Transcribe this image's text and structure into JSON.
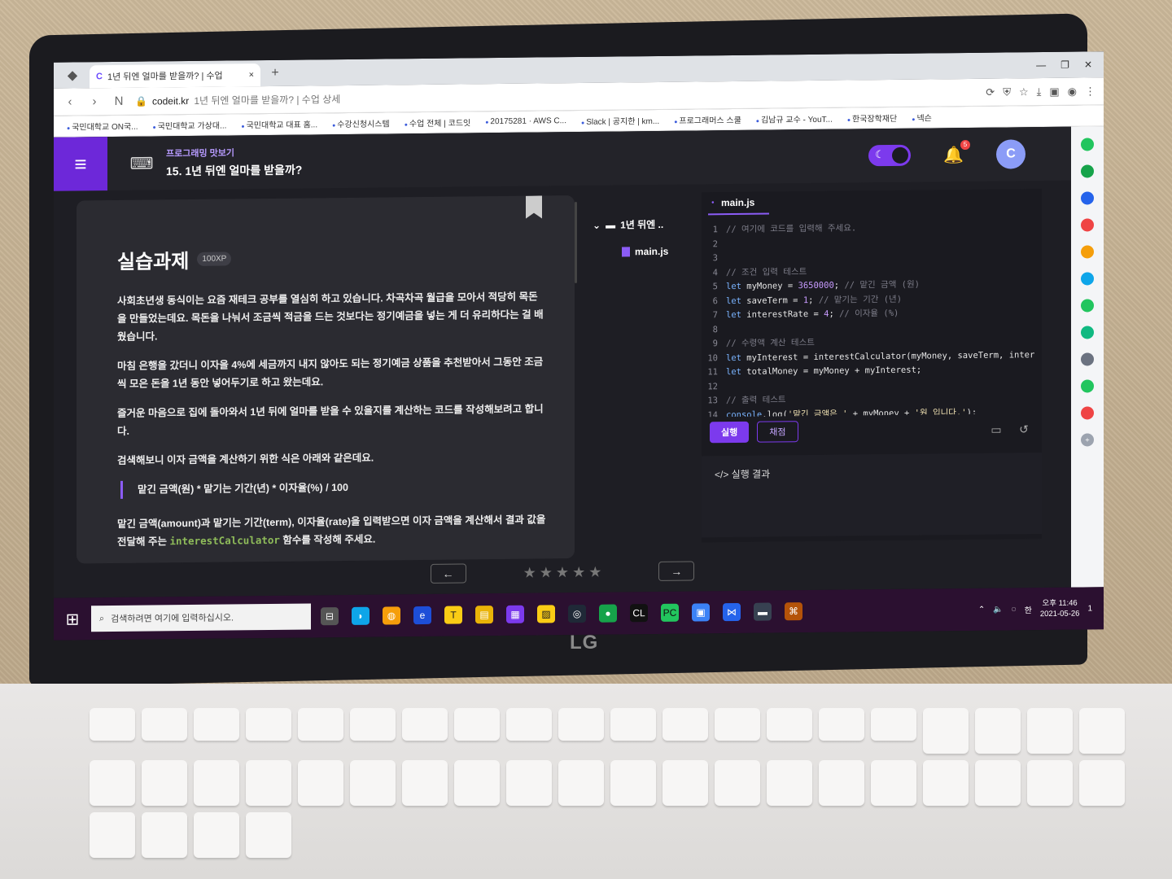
{
  "browser": {
    "tab_title": "1년 뒤엔 얼마를 받을까? | 수업",
    "tab_close": "×",
    "new_tab": "+",
    "window_controls": [
      "—",
      "❐",
      "✕"
    ],
    "url_domain": "codeit.kr",
    "url_path": "1년 뒤엔 얼마를 받을까? | 수업 상세",
    "bookmarks": [
      "국민대학교 ON국...",
      "국민대학교 가상대...",
      "국민대학교 대표 홈...",
      "수강신청시스템",
      "수업 전체 | 코드잇",
      "20175281 · AWS C...",
      "Slack | 공지한 | km...",
      "프로그래머스 스쿨",
      "김남규 교수 - YouT...",
      "한국장학재단",
      "넥슨"
    ]
  },
  "header": {
    "course_name": "프로그래밍 맛보기",
    "lesson_title": "15. 1년 뒤엔 얼마를 받을까?",
    "notification_count": "5",
    "avatar_letter": "C"
  },
  "task": {
    "title": "실습과제",
    "xp": "100XP",
    "p1": "사회초년생 동식이는 요즘 재테크 공부를 열심히 하고 있습니다. 차곡차곡 월급을 모아서 적당히 목돈을 만들었는데요. 목돈을 나눠서 조금씩 적금을 드는 것보다는 정기예금을 넣는 게 더 유리하다는 걸 배웠습니다.",
    "p2": "마침 은행을 갔더니 이자을 4%에 세금까지 내지 않아도 되는 정기예금 상품을 추천받아서 그동안 조금씩 모은 돈을 1년 동안 넣어두기로 하고 왔는데요.",
    "p3": "즐거운 마음으로 집에 돌아와서 1년 뒤에 얼마를 받을 수 있을지를 계산하는 코드를 작성해보려고 합니다.",
    "p4": "검색해보니 이자 금액을 계산하기 위한 식은 아래와 같은데요.",
    "formula": "맡긴 금액(원) * 맡기는 기간(년) * 이자율(%) / 100",
    "p5_start": "맡긴 금액(amount)과 맡기는 기간(term), 이자율(rate)을 입력받으면 이자 금액을 계산해서 결과 값을 전달해 주는",
    "p5_code": "interestCalculator",
    "p5_end": "함수를 작성해 주세요."
  },
  "filetree": {
    "folder": "1년 뒤엔 ..",
    "file": "main.js"
  },
  "editor": {
    "tab": "main.js",
    "run_label": "실행",
    "grade_label": "채점",
    "result_label": "</> 실행 결과",
    "lines": [
      {
        "n": "1",
        "html": "<span class='cm'>// 여기에 코드를 입력해 주세요.</span>"
      },
      {
        "n": "2",
        "html": ""
      },
      {
        "n": "3",
        "html": ""
      },
      {
        "n": "4",
        "html": "<span class='cm'>// 조건 입력 테스트</span>"
      },
      {
        "n": "5",
        "html": "<span class='kw'>let</span> myMoney = <span class='num'>3650000</span>; <span class='cm'>// 맡긴 금액 (원)</span>"
      },
      {
        "n": "6",
        "html": "<span class='kw'>let</span> saveTerm = <span class='num'>1</span>; <span class='cm'>// 맡기는 기간 (년)</span>"
      },
      {
        "n": "7",
        "html": "<span class='kw'>let</span> interestRate = <span class='num'>4</span>; <span class='cm'>// 이자율 (%)</span>"
      },
      {
        "n": "8",
        "html": ""
      },
      {
        "n": "9",
        "html": "<span class='cm'>// 수령액 계산 테스트</span>"
      },
      {
        "n": "10",
        "html": "<span class='kw'>let</span> myInterest = interestCalculator(myMoney, saveTerm, inter"
      },
      {
        "n": "11",
        "html": "<span class='kw'>let</span> totalMoney = myMoney + myInterest;"
      },
      {
        "n": "12",
        "html": ""
      },
      {
        "n": "13",
        "html": "<span class='cm'>// 출력 테스트</span>"
      },
      {
        "n": "14",
        "html": "<span class='kw'>console</span>.log(<span class='str'>'맡긴 금액은 '</span> + myMoney + <span class='str'>'원 입니다.'</span>);"
      }
    ]
  },
  "bottom_nav": {
    "prev": "←",
    "next": "→",
    "rating": 0,
    "rating_max": 5
  },
  "taskbar": {
    "search_placeholder": "검색하려면 여기에 입력하십시오.",
    "time": "오후 11:46",
    "date": "2021-05-26",
    "notif": "1"
  },
  "device": {
    "brand": "LG"
  },
  "colors": {
    "accent": "#7c3aed",
    "background": "#1e1e24",
    "card": "#2b2b31",
    "taskbar": "#2b1030"
  }
}
